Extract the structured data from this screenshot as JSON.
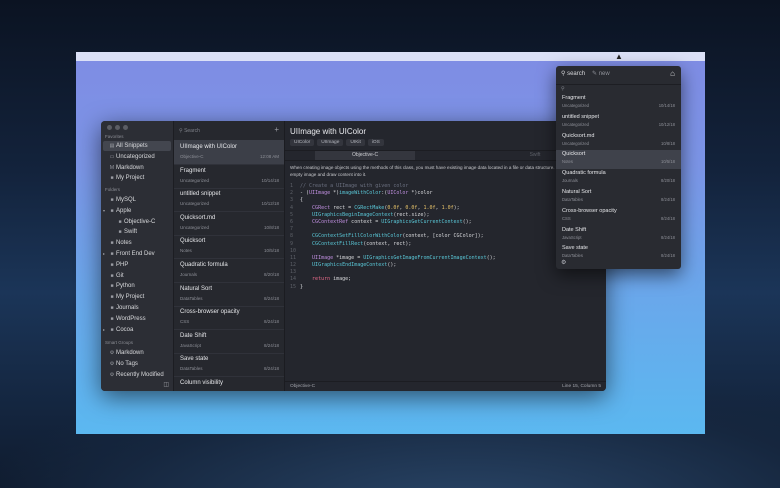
{
  "menubar": {
    "icon": "app-status-icon"
  },
  "sidebar": {
    "favorites_label": "Favorites",
    "favorites": [
      {
        "label": "All Snippets",
        "icon": "snippets-icon",
        "selected": true
      },
      {
        "label": "Uncategorized",
        "icon": "tray-icon"
      },
      {
        "label": "Markdown",
        "icon": "markdown-icon"
      },
      {
        "label": "My Project",
        "icon": "folder-icon"
      }
    ],
    "folders_label": "Folders",
    "folders": [
      {
        "label": "MySQL",
        "icon": "folder-icon"
      },
      {
        "label": "Apple",
        "icon": "folder-icon",
        "expanded": true
      },
      {
        "label": "Objective-C",
        "icon": "folder-icon",
        "child": true
      },
      {
        "label": "Swift",
        "icon": "folder-icon",
        "child": true
      },
      {
        "label": "Notes",
        "icon": "folder-icon"
      },
      {
        "label": "Front End Dev",
        "icon": "folder-icon",
        "collapsed": true
      },
      {
        "label": "PHP",
        "icon": "folder-icon"
      },
      {
        "label": "Git",
        "icon": "folder-icon"
      },
      {
        "label": "Python",
        "icon": "folder-icon"
      },
      {
        "label": "My Project",
        "icon": "folder-icon"
      },
      {
        "label": "Journals",
        "icon": "folder-icon"
      },
      {
        "label": "WordPress",
        "icon": "folder-icon"
      },
      {
        "label": "Cocoa",
        "icon": "folder-icon",
        "collapsed": true
      }
    ],
    "smart_label": "Smart Groups",
    "smart": [
      {
        "label": "Markdown",
        "icon": "gear-icon"
      },
      {
        "label": "No Tags",
        "icon": "gear-icon"
      },
      {
        "label": "Recently Modified",
        "icon": "gear-icon"
      }
    ]
  },
  "list": {
    "search_placeholder": "Search",
    "add_label": "+",
    "items": [
      {
        "title": "UIImage with UIColor",
        "category": "Objective-C",
        "date": "12:08 AM",
        "selected": true
      },
      {
        "title": "Fragment",
        "category": "Uncategorized",
        "date": "10/14/18"
      },
      {
        "title": "untitled snippet",
        "category": "Uncategorized",
        "date": "10/12/18"
      },
      {
        "title": "Quicksort.md",
        "category": "Uncategorized",
        "date": "10/8/18"
      },
      {
        "title": "Quicksort",
        "category": "Notes",
        "date": "10/5/18"
      },
      {
        "title": "Quadratic formula",
        "category": "Journals",
        "date": "8/20/18"
      },
      {
        "title": "Natural Sort",
        "category": "DataTables",
        "date": "8/24/18"
      },
      {
        "title": "Cross-browser opacity",
        "category": "CSS",
        "date": "8/24/18"
      },
      {
        "title": "Date Shift",
        "category": "JavaScript",
        "date": "8/24/18"
      },
      {
        "title": "Save state",
        "category": "DataTables",
        "date": "8/24/18"
      },
      {
        "title": "Column visibility",
        "category": "",
        "date": ""
      }
    ]
  },
  "editor": {
    "title": "UIImage with UIColor",
    "tags": [
      "UIColor",
      "UIImage",
      "UIKit",
      "iOS"
    ],
    "tab_active": "Objective-C",
    "tab_inactive": "Swift",
    "description": "When creating image objects using the methods of this class, you must have existing image data located in a file or data structure. You cannot create an empty image and draw content into it.",
    "status_language": "Objective-C",
    "status_position": "Line 15, Column 5"
  },
  "popover": {
    "search_label": "search",
    "new_label": "new",
    "search_placeholder": "",
    "items": [
      {
        "title": "Fragment",
        "category": "Uncategorized",
        "date": "10/14/18"
      },
      {
        "title": "untitled snippet",
        "category": "Uncategorized",
        "date": "10/12/18"
      },
      {
        "title": "Quicksort.md",
        "category": "Uncategorized",
        "date": "10/8/18"
      },
      {
        "title": "Quicksort",
        "category": "Notes",
        "date": "10/5/18",
        "selected": true
      },
      {
        "title": "Quadratic formula",
        "category": "Journals",
        "date": "8/20/18"
      },
      {
        "title": "Natural Sort",
        "category": "DataTables",
        "date": "8/24/18"
      },
      {
        "title": "Cross-browser opacity",
        "category": "CSS",
        "date": "8/24/18"
      },
      {
        "title": "Date Shift",
        "category": "JavaScript",
        "date": "8/24/18"
      },
      {
        "title": "Save state",
        "category": "DataTables",
        "date": "8/24/18"
      }
    ]
  }
}
